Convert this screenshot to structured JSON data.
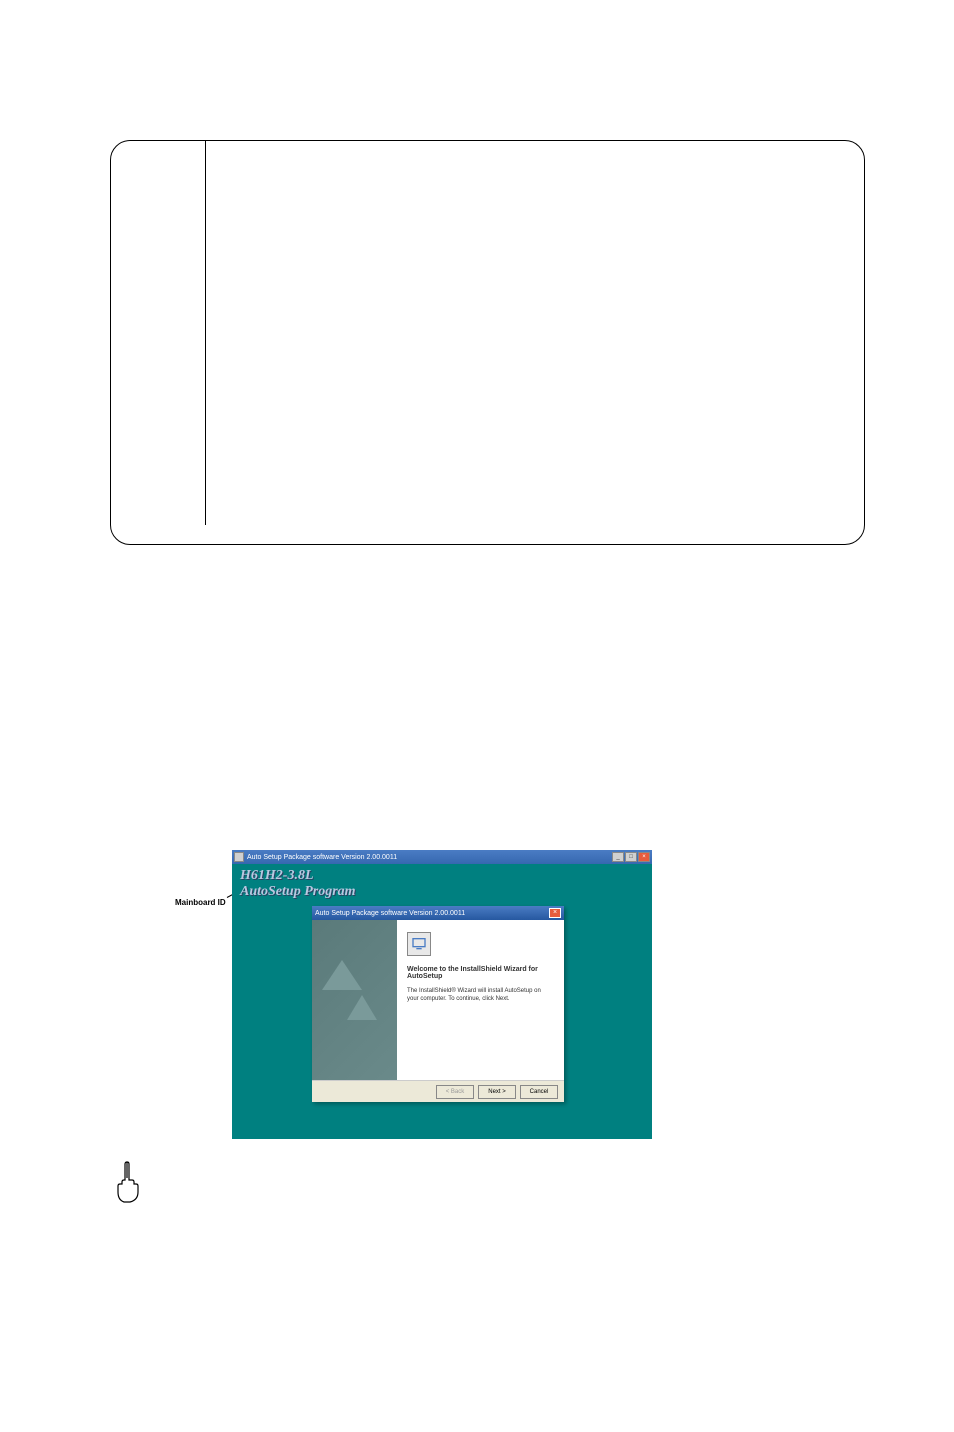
{
  "outer_window": {
    "title": "Auto Setup Package software Version 2.00.0011"
  },
  "brand": {
    "line1": "H61H2-3.8L",
    "line2": "AutoSetup Program"
  },
  "mainboard_label": "Mainboard ID",
  "inner_dialog": {
    "title": "Auto Setup Package software Version 2.00.0011",
    "welcome": "Welcome to the InstallShield Wizard for AutoSetup",
    "description": "The InstallShield® Wizard will install AutoSetup on your computer. To continue, click Next.",
    "buttons": {
      "back": "< Back",
      "next": "Next >",
      "cancel": "Cancel"
    }
  }
}
